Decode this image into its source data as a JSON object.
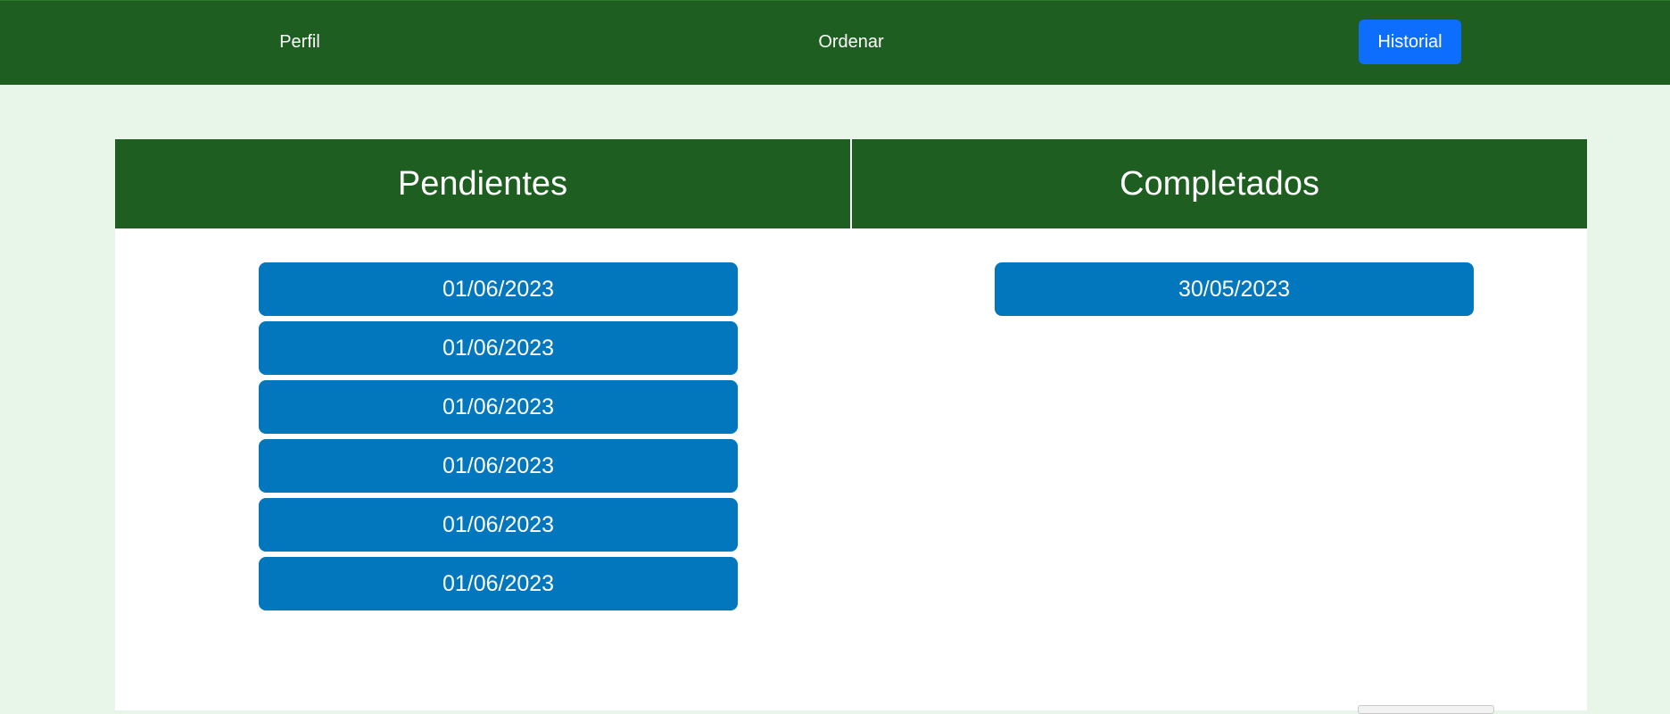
{
  "nav": {
    "perfil": "Perfil",
    "ordenar": "Ordenar",
    "historial": "Historial",
    "active": "historial"
  },
  "columns": {
    "pendientes": {
      "title": "Pendientes",
      "dates": [
        "01/06/2023",
        "01/06/2023",
        "01/06/2023",
        "01/06/2023",
        "01/06/2023",
        "01/06/2023"
      ]
    },
    "completados": {
      "title": "Completados",
      "dates": [
        "30/05/2023"
      ]
    }
  },
  "colors": {
    "nav_bg": "#1e5e20",
    "page_bg": "#e8f5e9",
    "active_nav": "#0d6efd",
    "date_button": "#0277bd"
  }
}
